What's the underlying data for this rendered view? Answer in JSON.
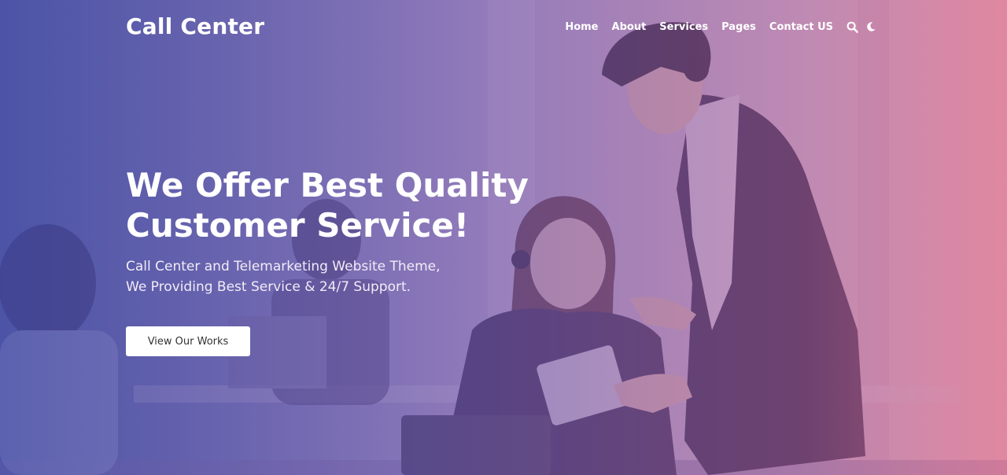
{
  "header": {
    "logo": "Call Center"
  },
  "nav": {
    "items": [
      {
        "label": "Home"
      },
      {
        "label": "About"
      },
      {
        "label": "Services"
      },
      {
        "label": "Pages"
      },
      {
        "label": "Contact US"
      }
    ],
    "search_icon": "search-icon",
    "theme_icon": "moon-icon"
  },
  "hero": {
    "title_line1": "We Offer Best Quality",
    "title_line2": "Customer Service!",
    "subtitle_line1": "Call Center and Telemarketing Website Theme,",
    "subtitle_line2": "We Providing Best Service & 24/7 Support.",
    "button_label": "View Our Works"
  },
  "colors": {
    "overlay_left": "#4348a4",
    "overlay_right": "#de6e8c",
    "button_bg": "#ffffff",
    "button_text": "#333333"
  }
}
